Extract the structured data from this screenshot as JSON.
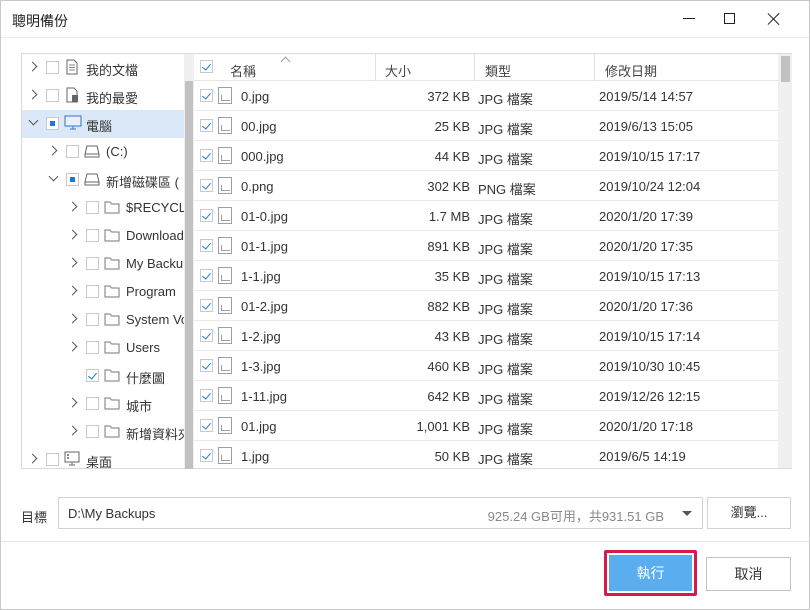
{
  "window": {
    "title": "聰明備份"
  },
  "tree": {
    "items": [
      {
        "label": "我的文檔",
        "expander": "right",
        "check": "none",
        "icon": "document-icon",
        "indent": 0
      },
      {
        "label": "我的最愛",
        "expander": "right",
        "check": "none",
        "icon": "favorites-icon",
        "indent": 0
      },
      {
        "label": "電腦",
        "expander": "down",
        "check": "partial",
        "icon": "computer-icon",
        "indent": 0,
        "selected": true
      },
      {
        "label": "(C:)",
        "expander": "right",
        "check": "none",
        "icon": "drive-icon",
        "indent": 1
      },
      {
        "label": "新增磁碟區 (",
        "expander": "down",
        "check": "partial",
        "icon": "drive-icon",
        "indent": 1
      },
      {
        "label": "$RECYCLE",
        "expander": "right",
        "check": "none",
        "icon": "folder-icon",
        "indent": 2
      },
      {
        "label": "Download",
        "expander": "right",
        "check": "none",
        "icon": "folder-icon",
        "indent": 2
      },
      {
        "label": "My Backu",
        "expander": "right",
        "check": "none",
        "icon": "folder-icon",
        "indent": 2
      },
      {
        "label": "Program",
        "expander": "right",
        "check": "none",
        "icon": "folder-icon",
        "indent": 2
      },
      {
        "label": "System Vo",
        "expander": "right",
        "check": "none",
        "icon": "folder-icon",
        "indent": 2
      },
      {
        "label": "Users",
        "expander": "right",
        "check": "none",
        "icon": "folder-icon",
        "indent": 2
      },
      {
        "label": "什麼圖",
        "expander": "none",
        "check": "checked",
        "icon": "folder-icon",
        "indent": 2
      },
      {
        "label": "城市",
        "expander": "right",
        "check": "none",
        "icon": "folder-icon",
        "indent": 2
      },
      {
        "label": "新增資料夾",
        "expander": "right",
        "check": "none",
        "icon": "folder-icon",
        "indent": 2
      },
      {
        "label": "桌面",
        "expander": "right",
        "check": "none",
        "icon": "desktop-icon",
        "indent": 0
      }
    ]
  },
  "list": {
    "headers": {
      "name": "名稱",
      "size": "大小",
      "type": "類型",
      "date": "修改日期"
    },
    "rows": [
      {
        "name": "0.jpg",
        "size": "372 KB",
        "type": "JPG 檔案",
        "date": "2019/5/14 14:57"
      },
      {
        "name": "00.jpg",
        "size": "25 KB",
        "type": "JPG 檔案",
        "date": "2019/6/13 15:05"
      },
      {
        "name": "000.jpg",
        "size": "44 KB",
        "type": "JPG 檔案",
        "date": "2019/10/15 17:17"
      },
      {
        "name": "0.png",
        "size": "302 KB",
        "type": "PNG 檔案",
        "date": "2019/10/24 12:04"
      },
      {
        "name": "01-0.jpg",
        "size": "1.7 MB",
        "type": "JPG 檔案",
        "date": "2020/1/20 17:39"
      },
      {
        "name": "01-1.jpg",
        "size": "891 KB",
        "type": "JPG 檔案",
        "date": "2020/1/20 17:35"
      },
      {
        "name": "1-1.jpg",
        "size": "35 KB",
        "type": "JPG 檔案",
        "date": "2019/10/15 17:13"
      },
      {
        "name": "01-2.jpg",
        "size": "882 KB",
        "type": "JPG 檔案",
        "date": "2020/1/20 17:36"
      },
      {
        "name": "1-2.jpg",
        "size": "43 KB",
        "type": "JPG 檔案",
        "date": "2019/10/15 17:14"
      },
      {
        "name": "1-3.jpg",
        "size": "460 KB",
        "type": "JPG 檔案",
        "date": "2019/10/30 10:45"
      },
      {
        "name": "1-11.jpg",
        "size": "642 KB",
        "type": "JPG 檔案",
        "date": "2019/12/26 12:15"
      },
      {
        "name": "01.jpg",
        "size": "1,001 KB",
        "type": "JPG 檔案",
        "date": "2020/1/20 17:18"
      },
      {
        "name": "1.jpg",
        "size": "50 KB",
        "type": "JPG 檔案",
        "date": "2019/6/5 14:19"
      }
    ]
  },
  "target": {
    "label": "目標",
    "path": "D:\\My Backups",
    "space": "925.24 GB可用，共931.51 GB",
    "browse_label": "瀏覽..."
  },
  "footer": {
    "run_label": "執行",
    "cancel_label": "取消"
  },
  "colors": {
    "accent": "#5aaef0",
    "highlight": "#d21b4e",
    "checkbox": "#1e78d7",
    "selected_row": "#dbe8f7"
  }
}
